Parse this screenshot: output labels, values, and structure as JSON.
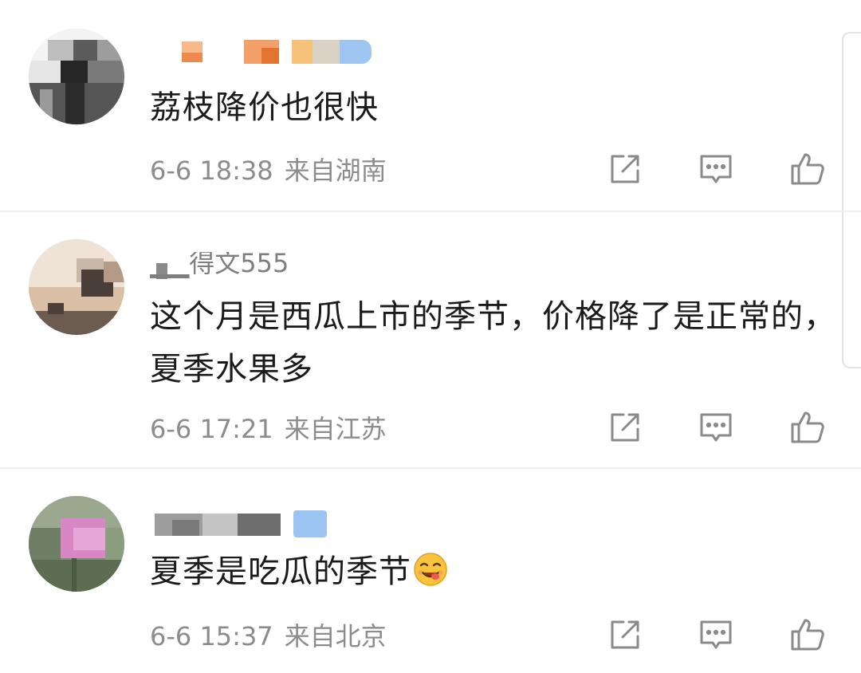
{
  "comments": [
    {
      "text": "荔枝降价也很快",
      "time": "6-6 18:38",
      "location": "来自湖南",
      "icons": [
        "repost-icon",
        "comment-icon",
        "like-icon"
      ]
    },
    {
      "username_visible": "▁▁得文555",
      "text": "这个月是西瓜上市的季节，价格降了是正常的，夏季水果多",
      "time": "6-6 17:21",
      "location": "来自江苏",
      "icons": [
        "repost-icon",
        "comment-icon",
        "like-icon"
      ]
    },
    {
      "text": "夏季是吃瓜的季节",
      "emoji": "yummy-face-emoji",
      "time": "6-6 15:37",
      "location": "来自北京",
      "icons": [
        "repost-icon",
        "comment-icon",
        "like-icon"
      ]
    }
  ],
  "colors": {
    "text": "#1b1b1b",
    "meta": "#8c8c8c",
    "icon": "#8a8a8a",
    "divider": "#efefef"
  }
}
